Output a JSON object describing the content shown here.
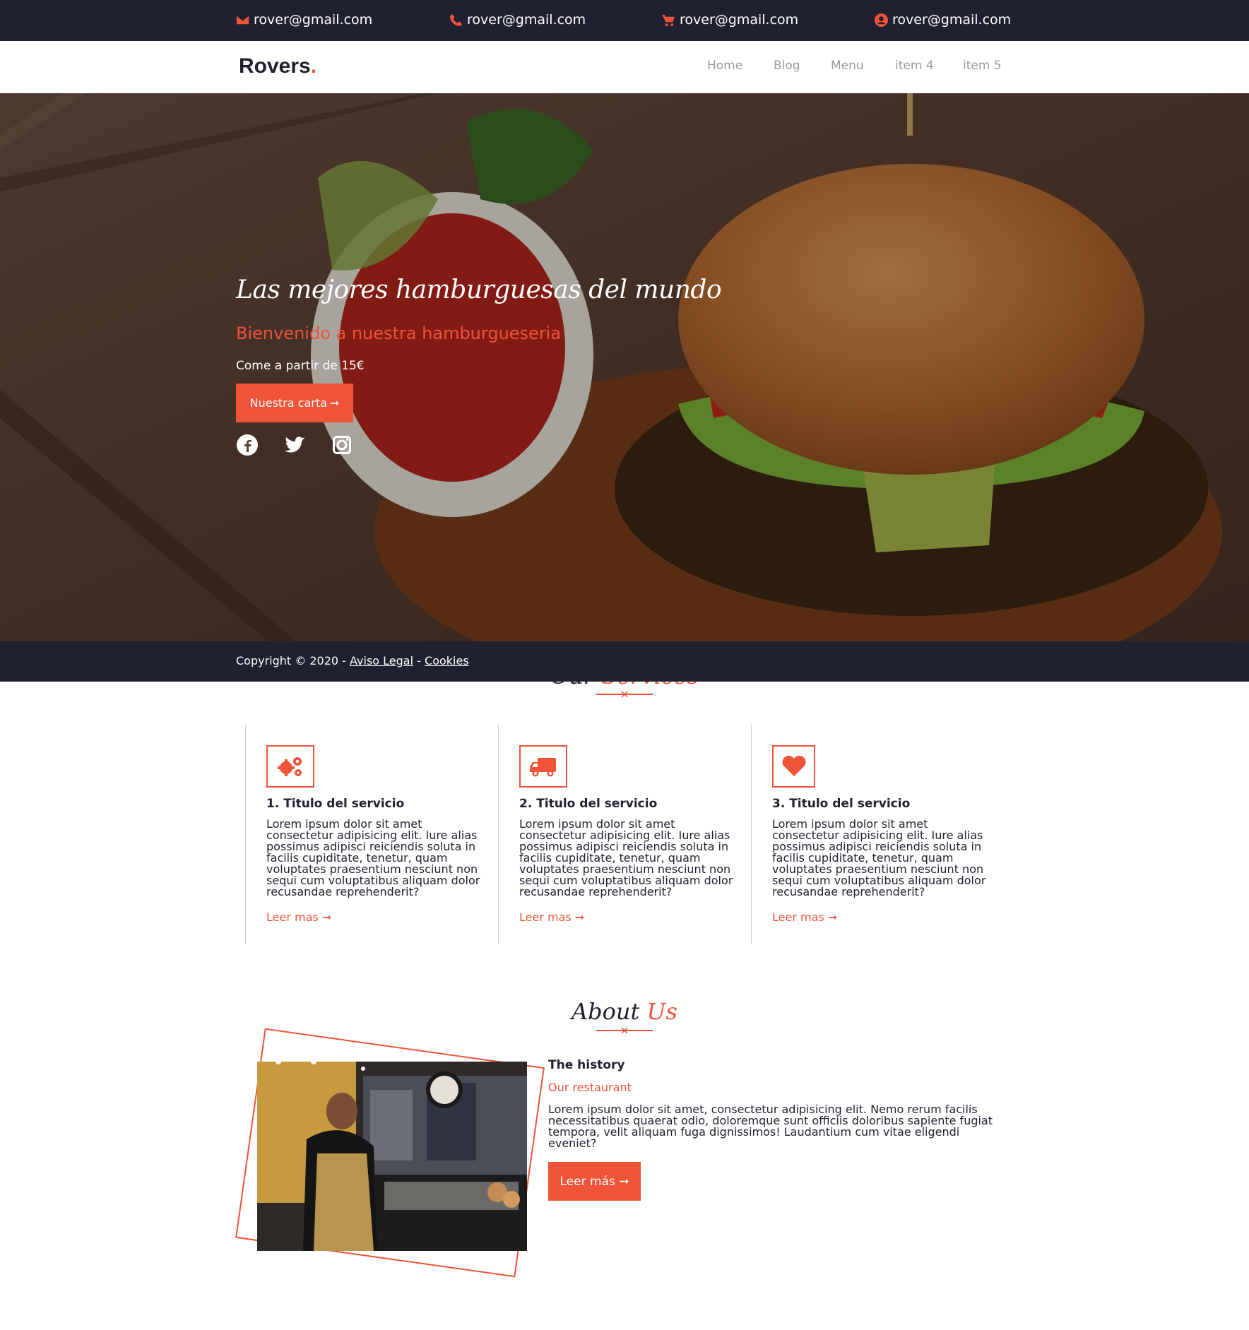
{
  "topbar": {
    "contacts": [
      {
        "icon": "envelope-icon",
        "text": "rover@gmail.com"
      },
      {
        "icon": "phone-icon",
        "text": "rover@gmail.com"
      },
      {
        "icon": "cart-icon",
        "text": "rover@gmail.com"
      },
      {
        "icon": "user-circle-icon",
        "text": "rover@gmail.com"
      }
    ]
  },
  "navbar": {
    "brand": "Rovers",
    "brand_dot": ".",
    "items": [
      "Home",
      "Blog",
      "Menu",
      "item 4",
      "item 5"
    ]
  },
  "hero": {
    "title": "Las mejores hamburguesas del mundo",
    "subtitle": "Bienvenido a nuestra hamburgueseria",
    "price_text": "Come a partir de 15€",
    "button_label": "Nuestra carta",
    "social": [
      "facebook-icon",
      "twitter-icon",
      "instagram-icon"
    ]
  },
  "footer": {
    "copyright": "Copyright © 2020 -",
    "separator": "-",
    "legal_link": "Aviso Legal",
    "cookies_link": "Cookies"
  },
  "services": {
    "title_main": "Our",
    "title_accent": "Services",
    "items": [
      {
        "icon": "gears-icon",
        "title": "1. Titulo del servicio",
        "text": "Lorem ipsum dolor sit amet consectetur adipisicing elit. Iure alias possimus adipisci reiciendis soluta in facilis cupiditate, tenetur, quam voluptates praesentium nesciunt non sequi cum voluptatibus aliquam dolor recusandae reprehenderit?",
        "link": "Leer mas"
      },
      {
        "icon": "truck-icon",
        "title": "2. Titulo del servicio",
        "text": "Lorem ipsum dolor sit amet consectetur adipisicing elit. Iure alias possimus adipisci reiciendis soluta in facilis cupiditate, tenetur, quam voluptates praesentium nesciunt non sequi cum voluptatibus aliquam dolor recusandae reprehenderit?",
        "link": "Leer mas"
      },
      {
        "icon": "heart-icon",
        "title": "3. Titulo del servicio",
        "text": "Lorem ipsum dolor sit amet consectetur adipisicing elit. Iure alias possimus adipisci reiciendis soluta in facilis cupiditate, tenetur, quam voluptates praesentium nesciunt non sequi cum voluptatibus aliquam dolor recusandae reprehenderit?",
        "link": "Leer mas"
      }
    ]
  },
  "about": {
    "title_main": "About",
    "title_accent": "Us",
    "heading": "The history",
    "subheading": "Our restaurant",
    "text": "Lorem ipsum dolor sit amet, consectetur adipisicing elit. Nemo rerum facilis necessitatibus quaerat odio, doloremque sunt officiis doloribus sapiente fugiat tempora, velit aliquam fuga dignissimos! Laudantium cum vitae eligendi eveniet?",
    "button_label": "Leer más"
  },
  "colors": {
    "accent": "#ef5338",
    "dark": "#1f2030"
  }
}
